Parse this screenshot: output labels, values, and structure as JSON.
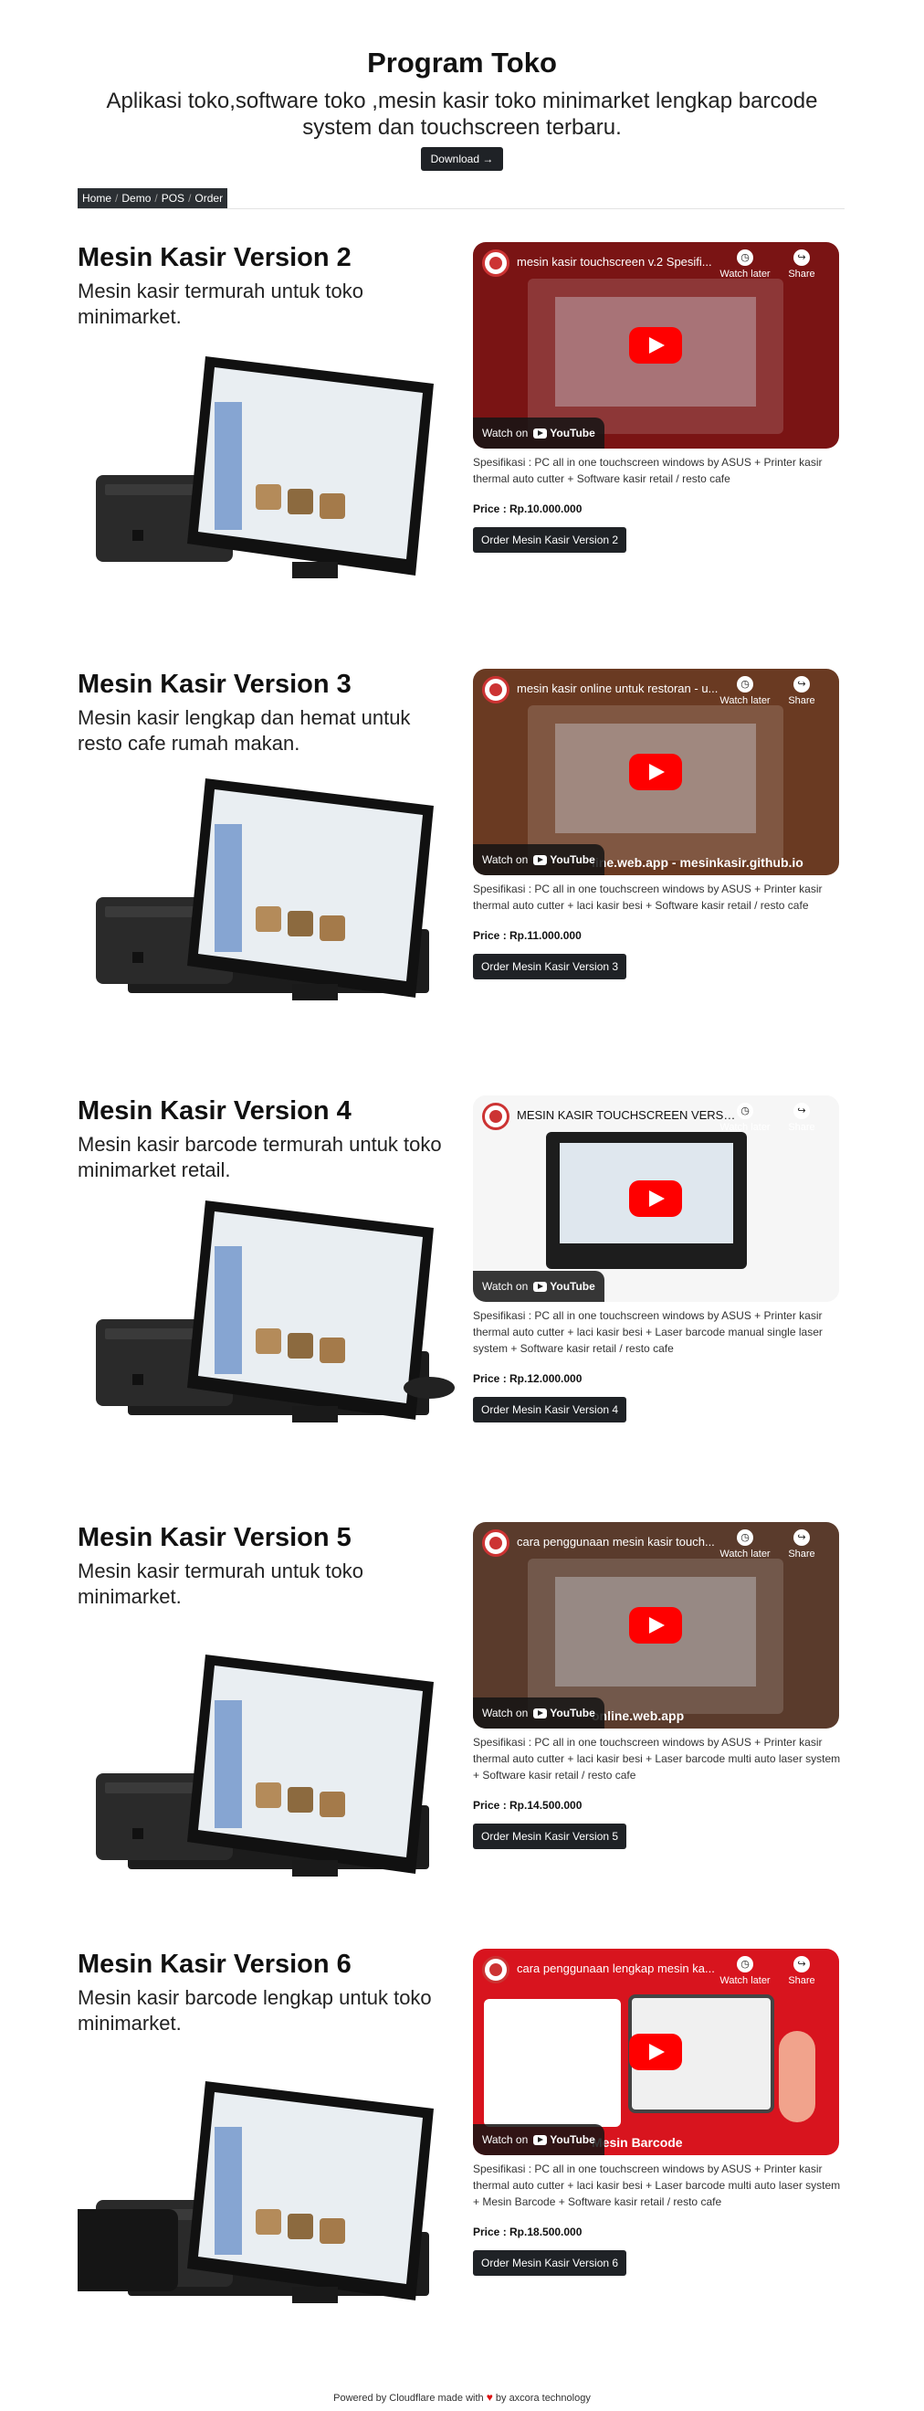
{
  "header": {
    "title": "Program Toko",
    "subtitle": "Aplikasi toko,software toko ,mesin kasir toko minimarket lengkap barcode system dan touchscreen terbaru.",
    "download_label": "Download →"
  },
  "breadcrumb": [
    "Home",
    "Demo",
    "POS",
    "Order"
  ],
  "products": [
    {
      "title": "Mesin Kasir Version 2",
      "description": "Mesin kasir termurah untuk toko minimarket.",
      "video_title": "mesin kasir touchscreen v.2 Spesifi...",
      "video_caption": "",
      "spec": "Spesifikasi : PC all in one touchscreen windows by ASUS + Printer kasir thermal auto cutter + Software kasir retail / resto cafe",
      "price": "Price : Rp.10.000.000",
      "order_label": "Order Mesin Kasir Version 2",
      "video_bg": "#7a1414"
    },
    {
      "title": "Mesin Kasir Version 3",
      "description": "Mesin kasir lengkap dan hemat untuk resto cafe rumah makan.",
      "video_title": "mesin kasir online untuk restoran - u...",
      "video_caption": "line.web.app - mesinkasir.github.io",
      "spec": "Spesifikasi : PC all in one touchscreen windows by ASUS + Printer kasir thermal auto cutter + laci kasir besi + Software kasir retail / resto cafe",
      "price": "Price : Rp.11.000.000",
      "order_label": "Order Mesin Kasir Version 3",
      "video_bg": "#6a3a22"
    },
    {
      "title": "Mesin Kasir Version 4",
      "description": "Mesin kasir barcode termurah untuk toko minimarket retail.",
      "video_title": "MESIN KASIR TOUCHSCREEN VERSION THREE",
      "video_caption": "",
      "spec": "Spesifikasi : PC all in one touchscreen windows by ASUS + Printer kasir thermal auto cutter + laci kasir besi + Laser barcode manual single laser system + Software kasir retail / resto cafe",
      "price": "Price : Rp.12.000.000",
      "order_label": "Order Mesin Kasir Version 4",
      "video_bg": "#f2f2f2"
    },
    {
      "title": "Mesin Kasir Version 5",
      "description": "Mesin kasir termurah untuk toko minimarket.",
      "video_title": "cara penggunaan mesin kasir touch...",
      "video_caption": "online.web.app",
      "spec": "Spesifikasi : PC all in one touchscreen windows by ASUS + Printer kasir thermal auto cutter + laci kasir besi + Laser barcode multi auto laser system + Software kasir retail / resto cafe",
      "price": "Price : Rp.14.500.000",
      "order_label": "Order Mesin Kasir Version 5",
      "video_bg": "#5a3b2c"
    },
    {
      "title": "Mesin Kasir Version 6",
      "description": "Mesin kasir barcode lengkap untuk toko minimarket.",
      "video_title": "cara penggunaan lengkap mesin ka...",
      "video_caption": "Mesin Barcode",
      "spec": "Spesifikasi : PC all in one touchscreen windows by ASUS + Printer kasir thermal auto cutter + laci kasir besi + Laser barcode multi auto laser system + Mesin Barcode + Software kasir retail / resto cafe",
      "price": "Price : Rp.18.500.000",
      "order_label": "Order Mesin Kasir Version 6",
      "video_bg": "#d8141e"
    }
  ],
  "video_ui": {
    "watch_later": "Watch later",
    "share": "Share",
    "watch_on": "Watch on",
    "youtube": "YouTube"
  },
  "footer": {
    "before": "Powered by Cloudflare made with",
    "after": "by axcora technology"
  }
}
